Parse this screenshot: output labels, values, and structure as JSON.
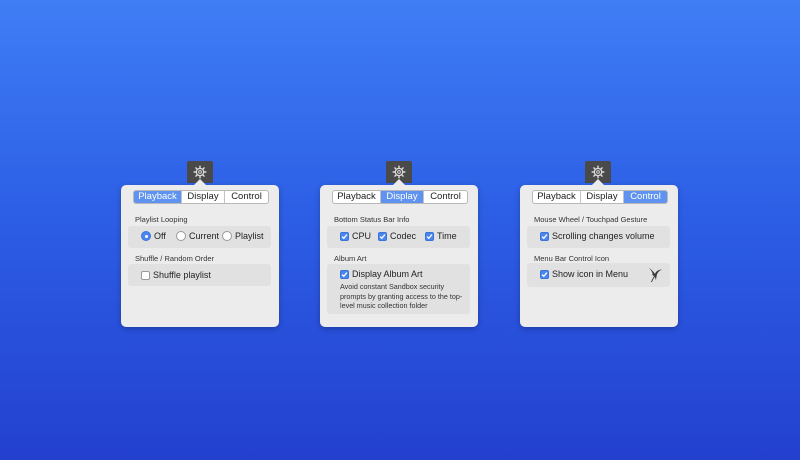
{
  "colors": {
    "background_top": "#3f7ef5",
    "background_bottom": "#2340cf",
    "accent": "#5f93ef",
    "popover": "#ececec"
  },
  "panels": [
    {
      "tabs": [
        "Playback",
        "Display",
        "Control"
      ],
      "active_tab": "Playback",
      "playlist_looping": {
        "label": "Playlist Looping",
        "options": [
          "Off",
          "Current",
          "Playlist"
        ],
        "selected": "Off"
      },
      "shuffle": {
        "label": "Shuffle / Random Order",
        "checkbox_label": "Shuffle playlist",
        "checked": false
      }
    },
    {
      "tabs": [
        "Playback",
        "Display",
        "Control"
      ],
      "active_tab": "Display",
      "status_bar": {
        "label": "Bottom Status Bar Info",
        "items": [
          {
            "label": "CPU",
            "checked": true
          },
          {
            "label": "Codec",
            "checked": true
          },
          {
            "label": "Time",
            "checked": true
          }
        ]
      },
      "album_art": {
        "label": "Album Art",
        "checkbox_label": "Display Album Art",
        "checked": true,
        "help_text": "Avoid constant Sandbox security prompts by granting access to the top-level music collection folder"
      }
    },
    {
      "tabs": [
        "Playback",
        "Display",
        "Control"
      ],
      "active_tab": "Control",
      "mouse_wheel": {
        "label": "Mouse Wheel / Touchpad Gesture",
        "checkbox_label": "Scrolling changes volume",
        "checked": true
      },
      "menu_bar_icon": {
        "label": "Menu Bar Control Icon",
        "checkbox_label": "Show icon in Menu",
        "checked": true,
        "icon": "hummingbird-icon"
      }
    }
  ]
}
